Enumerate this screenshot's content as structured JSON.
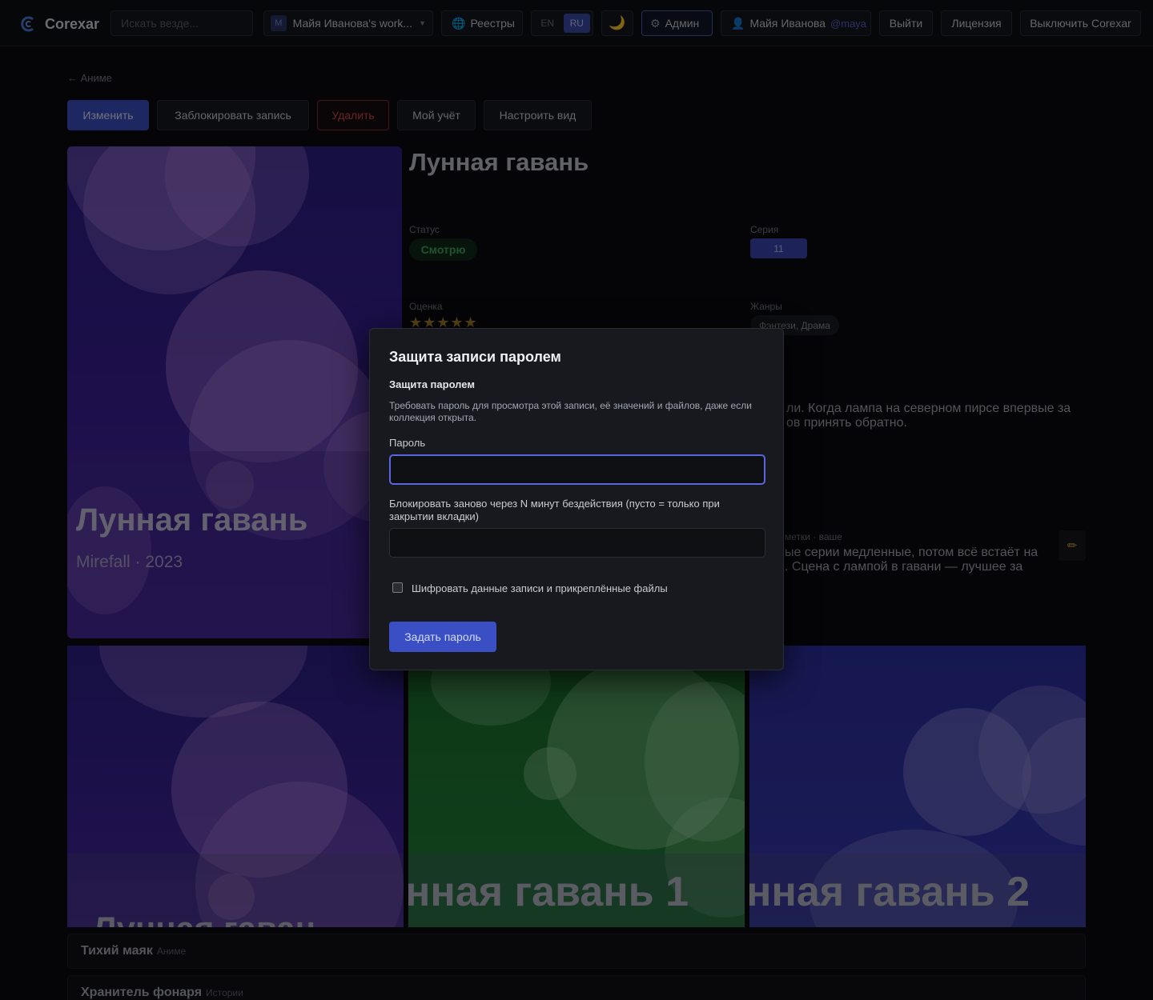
{
  "app": {
    "name": "Corexar"
  },
  "topbar": {
    "search_placeholder": "Искать везде...",
    "workspace_badge": "M",
    "workspace_name": "Майя Иванова's work...",
    "registries": "Реестры",
    "lang_en": "EN",
    "lang_ru": "RU",
    "theme_icon": "🌙",
    "admin": "Админ",
    "user_name": "Майя Иванова",
    "user_handle": "@maya",
    "logout": "Выйти",
    "license": "Лицензия",
    "disable": "Выключить Corexar"
  },
  "page": {
    "back_label": "← Аниме",
    "buttons": {
      "edit": "Изменить",
      "lock": "Заблокировать запись",
      "delete": "Удалить",
      "my_account": "Мой учёт",
      "customize_view": "Настроить вид"
    },
    "cover": {
      "title": "Лунная гавань",
      "subtitle": "Mirefall · 2023"
    },
    "title": "Лунная гавань",
    "fields": {
      "status_label": "Статус",
      "status_value": "Смотрю",
      "episode_label": "Серия",
      "episode_value": "11",
      "rating_label": "Оценка",
      "rating_stars": "★★★★★",
      "rating_value": 5,
      "genres_label": "Жанры",
      "genres_value": "Фэнтези, Драма"
    },
    "description_visible": "ли. Когда лампа на северном пирсе впервые за\nов принять обратно.",
    "notes_label_visible": "метки · ваше",
    "notes_text_visible": "ые серии медленные, потом всё встаёт на\n. Сцена с лампой в гавани — лучшее за",
    "gallery": [
      {
        "text": "Лунная гаван",
        "color": "#3a2596"
      },
      {
        "text": "нная гавань 1",
        "color": "#1e7a34"
      },
      {
        "text": "нная гавань 2",
        "color": "#3438b0"
      }
    ],
    "related": [
      {
        "title": "Тихий маяк",
        "type": "Аниме"
      },
      {
        "title": "Хранитель фонаря",
        "type": "Истории"
      }
    ]
  },
  "modal": {
    "title": "Защита записи паролем",
    "section_title": "Защита паролем",
    "help": "Требовать пароль для просмотра этой записи, её значений и файлов, даже если коллекция открыта.",
    "password_label": "Пароль",
    "password_value": "",
    "relock_label": "Блокировать заново через N минут бездействия (пусто = только при закрытии вкладки)",
    "relock_value": "",
    "encrypt_label": "Шифровать данные записи и прикреплённые файлы",
    "encrypt_checked": false,
    "submit": "Задать пароль"
  },
  "colors": {
    "accent": "#3b4fc4",
    "danger": "#d24646",
    "status_green": "#3fa65c",
    "star": "#b8882a"
  }
}
